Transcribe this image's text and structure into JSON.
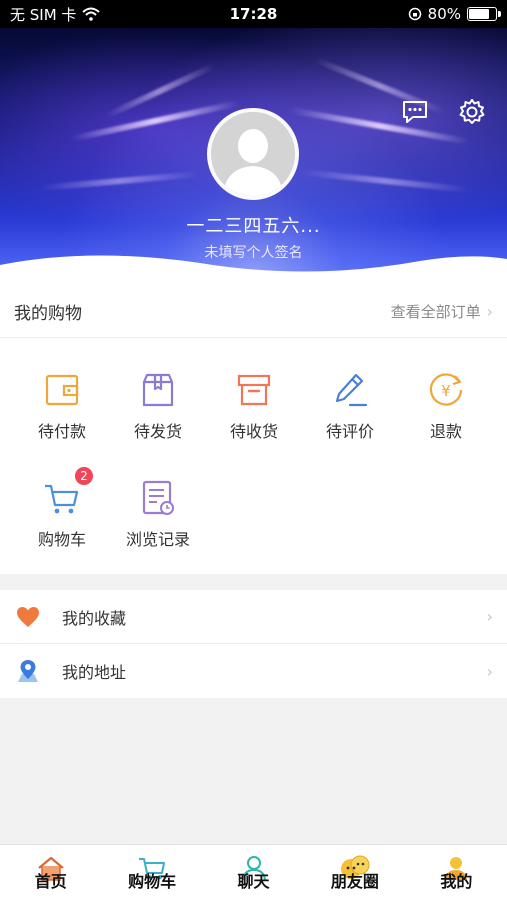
{
  "status_bar": {
    "carrier": "无 SIM 卡",
    "time": "17:28",
    "battery_text": "80%",
    "battery_level": 0.8
  },
  "profile": {
    "username": "一二三四五六...",
    "signature": "未填写个人签名"
  },
  "header_icons": {
    "message": "message-icon",
    "settings": "gear-icon"
  },
  "shopping": {
    "title": "我的购物",
    "view_all": "查看全部订单",
    "items": [
      {
        "label": "待付款",
        "icon": "wallet-icon"
      },
      {
        "label": "待发货",
        "icon": "package-icon"
      },
      {
        "label": "待收货",
        "icon": "receive-box-icon"
      },
      {
        "label": "待评价",
        "icon": "pencil-icon"
      },
      {
        "label": "退款",
        "icon": "refund-yuan-icon"
      },
      {
        "label": "购物车",
        "icon": "cart-icon",
        "badge": "2"
      },
      {
        "label": "浏览记录",
        "icon": "history-icon"
      }
    ]
  },
  "menu": [
    {
      "label": "我的收藏",
      "icon": "heart-icon"
    },
    {
      "label": "我的地址",
      "icon": "location-icon"
    }
  ],
  "tabbar": [
    {
      "label": "首页",
      "icon": "home-icon"
    },
    {
      "label": "购物车",
      "icon": "cart-icon"
    },
    {
      "label": "聊天",
      "icon": "person-icon"
    },
    {
      "label": "朋友圈",
      "icon": "friends-icon"
    },
    {
      "label": "我的",
      "icon": "profile-icon"
    }
  ],
  "colors": {
    "accent_orange": "#f0a63a",
    "accent_purple": "#8c7bd6",
    "accent_red": "#f0465a",
    "accent_blue": "#4a7fd8",
    "heart": "#f07a3e"
  }
}
